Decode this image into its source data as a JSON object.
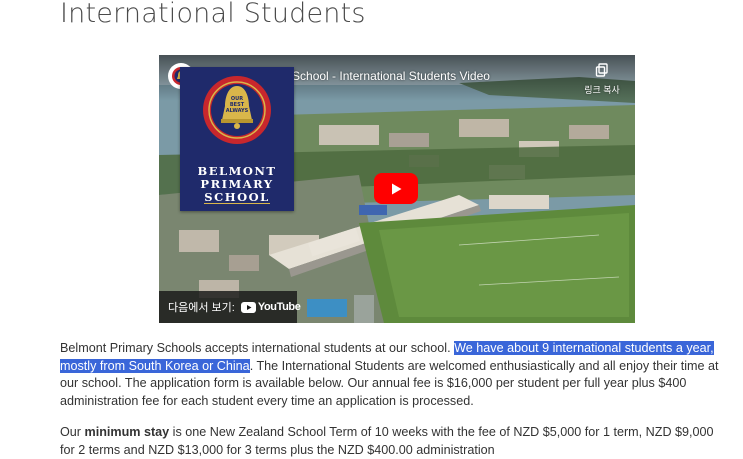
{
  "page": {
    "title": "International Students"
  },
  "video": {
    "title": "Belmont Primary School - International Students Video",
    "copy_link_label": "링크 복사",
    "watch_on_label": "다음에서 보기:",
    "youtube_wordmark": "YouTube",
    "logo": {
      "motto_line1": "OUR",
      "motto_line2": "BEST",
      "motto_line3": "ALWAYS",
      "name_line1": "BELMONT",
      "name_line2": "PRIMARY",
      "name_line3": "SCHOOL"
    },
    "icons": {
      "avatar": "school-crest-icon",
      "copy": "copy-link-icon",
      "play": "play-icon",
      "youtube": "youtube-icon"
    },
    "colors": {
      "play_button": "#ff0000",
      "logo_background": "#1f2a6b",
      "bell_gold": "#d9b64a"
    }
  },
  "content": {
    "para1_before": "Belmont Primary Schools accepts international students at our school. ",
    "para1_highlight": "We have about 9 international students a year, mostly from South Korea or China",
    "para1_after": ". The International Students are welcomed enthusiastically and all enjoy their time at our school. The application form is available below. Our annual fee is $16,000 per student per full year plus $400 administration fee for each student every time an application is processed.",
    "para2_before": "Our ",
    "para2_bold": "minimum stay",
    "para2_after": " is one New Zealand School Term of 10 weeks with the fee of NZD $5,000 for 1 term, NZD $9,000 for 2 terms and NZD $13,000 for 3 terms  plus the NZD $400.00 administration"
  },
  "colors": {
    "text_highlight": "#3a66d9"
  }
}
